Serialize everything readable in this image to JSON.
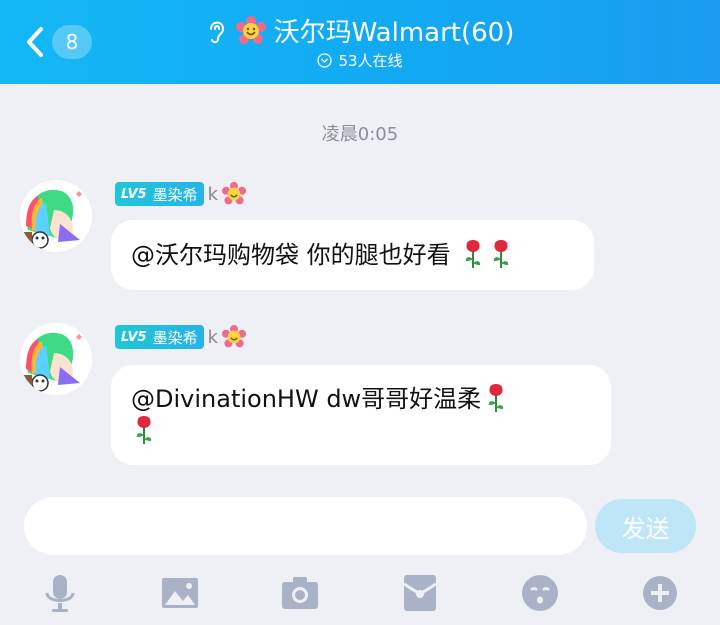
{
  "header": {
    "unread_count": "8",
    "title": "沃尔玛Walmart(60)",
    "online_text": "53人在线"
  },
  "chat": {
    "timestamp": "凌晨0:05",
    "messages": [
      {
        "level_badge": "LV5",
        "sender_name": "墨染希",
        "sender_suffix": "k",
        "text": "@沃尔玛购物袋 你的腿也好看"
      },
      {
        "level_badge": "LV5",
        "sender_name": "墨染希",
        "sender_suffix": "k",
        "text_line1": "@DivinationHW dw哥哥好温柔"
      }
    ]
  },
  "composer": {
    "input_value": "",
    "send_label": "发送"
  },
  "toolbar": {
    "items": [
      "microphone-icon",
      "image-icon",
      "camera-icon",
      "red-packet-icon",
      "emoji-icon",
      "plus-icon"
    ]
  },
  "colors": {
    "header_blue": "#14b8f5",
    "background": "#eef0f6",
    "send_disabled": "#bfe6f7",
    "toolbar_icon": "#a9b2c7"
  }
}
